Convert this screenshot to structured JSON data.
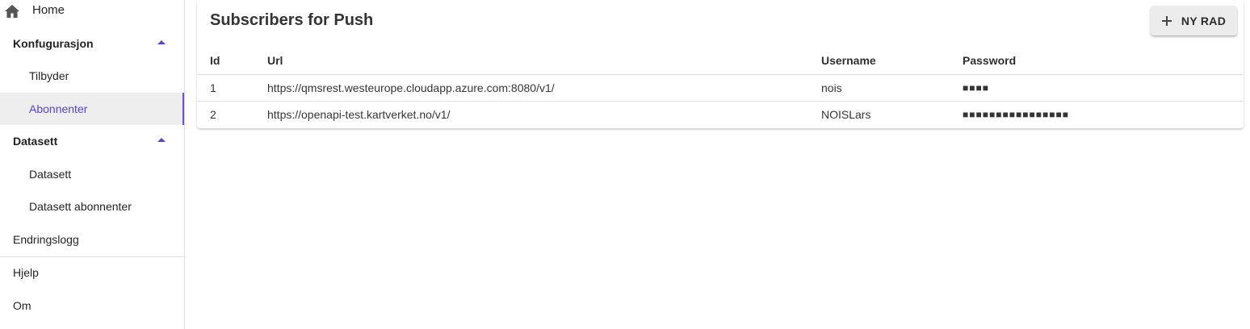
{
  "sidebar": {
    "home_label": "Home",
    "section_konfig": "Konfugurasjon",
    "item_tilbyder": "Tilbyder",
    "item_abonnenter": "Abonnenter",
    "section_datasett": "Datasett",
    "item_datasett": "Datasett",
    "item_datasett_abonnenter": "Datasett abonnenter",
    "item_endringslogg": "Endringslogg",
    "item_hjelp": "Hjelp",
    "item_om": "Om",
    "accent_color": "#5b3fd6"
  },
  "main": {
    "title": "Subscribers for Push",
    "add_button_label": "NY RAD",
    "columns": [
      "Id",
      "Url",
      "Username",
      "Password"
    ],
    "rows": [
      {
        "id": "1",
        "url": "https://qmsrest.westeurope.cloudapp.azure.com:8080/v1/",
        "username": "nois",
        "password": "■■■■"
      },
      {
        "id": "2",
        "url": "https://openapi-test.kartverket.no/v1/",
        "username": "NOISLars",
        "password": "■■■■■■■■■■■■■■■■"
      }
    ]
  }
}
